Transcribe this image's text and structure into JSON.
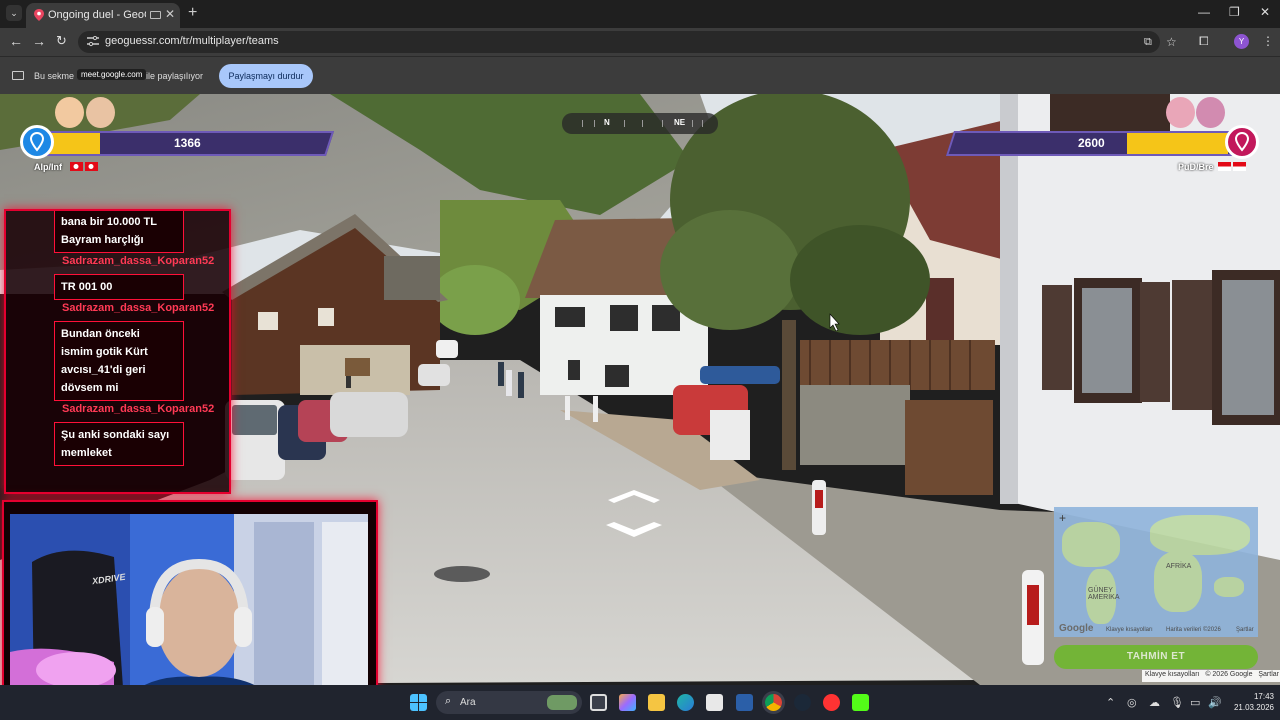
{
  "browser": {
    "tab_title": "Ongoing duel - GeoGuessr",
    "tab_close": "✕",
    "new_tab": "+",
    "url": "geoguessr.com/tr/multiplayer/teams",
    "profile_initial": "Y",
    "window_controls": [
      "—",
      "❐",
      "✕"
    ]
  },
  "share_bar": {
    "text_before": "Bu sekme",
    "site_chip": "meet.google.com",
    "text_after": "ile paylaşılıyor",
    "stop_button": "Paylaşmayı durdur"
  },
  "game": {
    "compass": {
      "labels": [
        "N",
        "NE"
      ]
    },
    "left_team": {
      "name": "Alp/Inf",
      "score": "1366",
      "health_fraction": 0.19,
      "color": "#1e88e5"
    },
    "right_team": {
      "name": "PuD/Bre",
      "score": "2600",
      "health_fraction": 0.38,
      "color": "#c2185b"
    },
    "guess_button": "TAHMİN ET",
    "map": {
      "labels": [
        "AFRİKA",
        "GÜNEY AMERİKA"
      ],
      "attribution": [
        "Google",
        "Klavye kısayolları",
        "Harita verileri ©2026",
        "Şartlar"
      ]
    },
    "footer": [
      "Klavye kısayolları",
      "© 2026 Google",
      "Şartlar"
    ]
  },
  "chat": {
    "messages": [
      {
        "text": [
          "bana bir 10.000 TL",
          "Bayram harçlığı"
        ]
      },
      {
        "user": "Sadrazam_dassa_Koparan52"
      },
      {
        "text": [
          "TR 001 00"
        ]
      },
      {
        "user": "Sadrazam_dassa_Koparan52"
      },
      {
        "text": [
          "Bundan önceki",
          "ismim gotik Kürt",
          "avcısı_41'di geri",
          "dövsem mi"
        ]
      },
      {
        "user": "Sadrazam_dassa_Koparan52"
      },
      {
        "text": [
          "Şu anki sondaki sayı",
          "memleket"
        ]
      }
    ]
  },
  "webcam": {
    "chair_brand": "XDRIVE"
  },
  "taskbar": {
    "search_placeholder": "Ara",
    "time": "17:43",
    "date": "21.03.2026"
  },
  "colors": {
    "accent_red": "#e3002f",
    "health_yellow": "#f5c518",
    "bar_purple": "#3b2f6b",
    "guess_green": "#6cb928",
    "share_button": "#a8c7fa"
  }
}
